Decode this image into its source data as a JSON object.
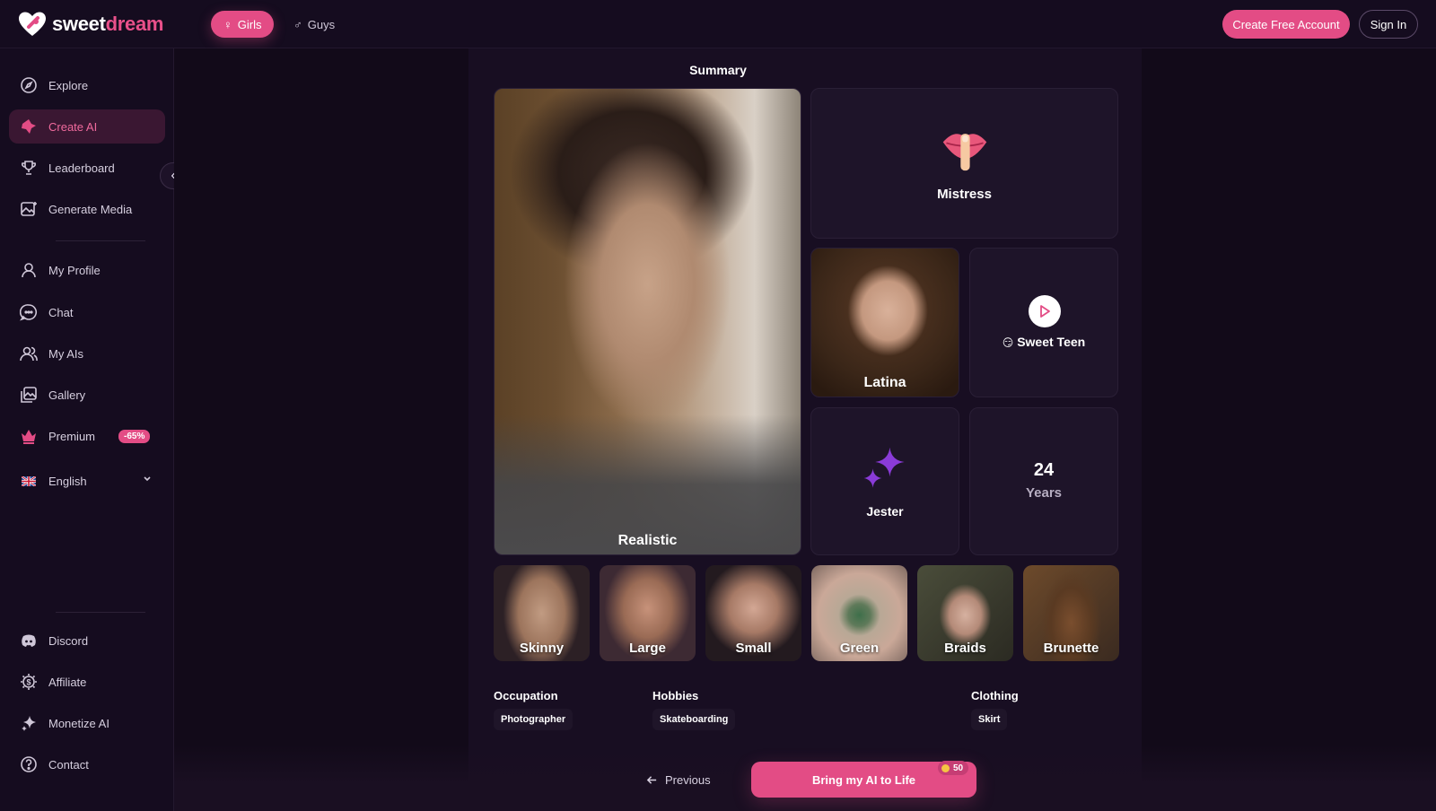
{
  "brand": {
    "name_part1": "sweet",
    "name_part2": "dream",
    "accent": "#e34c85"
  },
  "header": {
    "tabs": [
      {
        "label": "Girls",
        "icon": "female-icon",
        "active": true
      },
      {
        "label": "Guys",
        "icon": "male-icon",
        "active": false
      }
    ],
    "create_account_label": "Create Free Account",
    "sign_in_label": "Sign In"
  },
  "sidebar": {
    "items": [
      {
        "label": "Explore",
        "icon": "compass-icon"
      },
      {
        "label": "Create AI",
        "icon": "create-ai-icon",
        "active": true
      },
      {
        "label": "Leaderboard",
        "icon": "trophy-icon"
      },
      {
        "label": "Generate Media",
        "icon": "image-sparkle-icon"
      },
      {
        "label": "My Profile",
        "icon": "user-icon"
      },
      {
        "label": "Chat",
        "icon": "chat-bubble-icon"
      },
      {
        "label": "My AIs",
        "icon": "users-icon"
      },
      {
        "label": "Gallery",
        "icon": "gallery-icon"
      },
      {
        "label": "Premium",
        "icon": "crown-icon",
        "badge": "-65%"
      }
    ],
    "language": {
      "label": "English",
      "icon": "uk-flag-icon"
    },
    "footer_items": [
      {
        "label": "Discord",
        "icon": "discord-icon"
      },
      {
        "label": "Affiliate",
        "icon": "dollar-gear-icon"
      },
      {
        "label": "Monetize AI",
        "icon": "sparkle-icon"
      },
      {
        "label": "Contact",
        "icon": "help-circle-icon"
      }
    ]
  },
  "summary": {
    "title": "Summary",
    "style_label": "Realistic",
    "personality_label": "Mistress",
    "ethnicity_label": "Latina",
    "voice_label": "Sweet Teen",
    "voice_emoji": "😏",
    "relationship_label": "Jester",
    "age_value": "24",
    "age_unit": "Years",
    "attributes": [
      "Skinny",
      "Large",
      "Small",
      "Green",
      "Braids",
      "Brunette"
    ],
    "details": [
      {
        "label": "Occupation",
        "value": "Photographer"
      },
      {
        "label": "Hobbies",
        "value": "Skateboarding"
      },
      {
        "label": "Clothing",
        "value": "Skirt"
      }
    ]
  },
  "footer": {
    "previous_label": "Previous",
    "cta_label": "Bring my AI to Life",
    "cost": "50"
  }
}
